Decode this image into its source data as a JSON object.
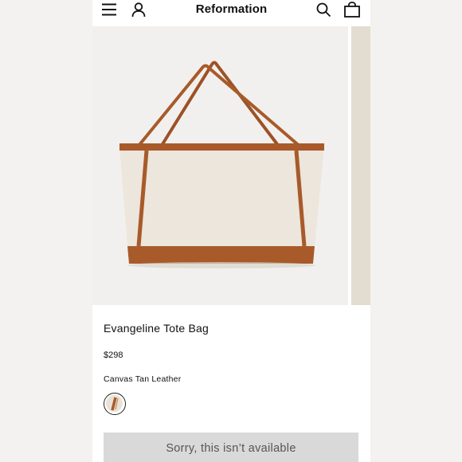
{
  "header": {
    "brand": "Reformation",
    "icons": [
      "menu-icon",
      "account-icon",
      "search-icon",
      "shopping-bag-icon"
    ]
  },
  "product": {
    "title": "Evangeline Tote Bag",
    "price": "$298",
    "color_name": "Canvas Tan Leather",
    "swatches": [
      {
        "name": "Canvas Tan Leather",
        "selected": true
      }
    ],
    "availability_button": "Sorry, this isn’t available"
  },
  "colors": {
    "canvas": "#ece6dc",
    "leather": "#a85a2a",
    "button_bg": "#d9d9d9"
  }
}
